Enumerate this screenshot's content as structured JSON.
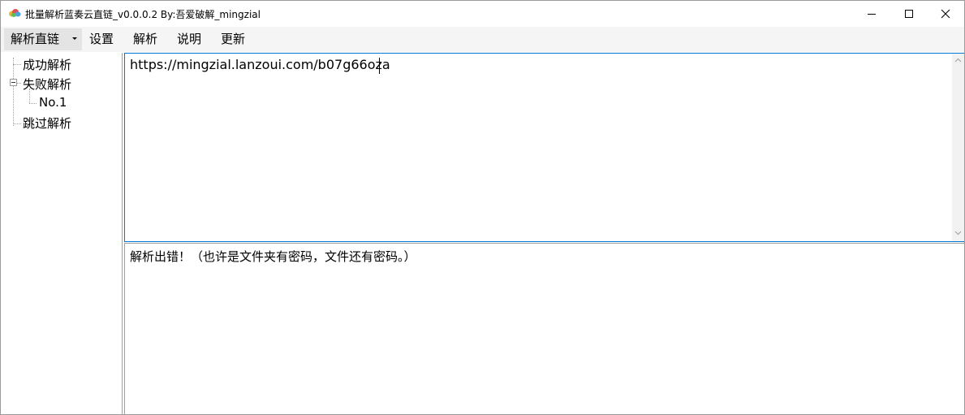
{
  "window": {
    "title": "批量解析蓝奏云直链_v0.0.0.2 By:吾爱破解_mingzial",
    "controls": {
      "minimize": "minimize",
      "maximize": "maximize",
      "close": "close"
    }
  },
  "menu": {
    "split_button": "解析直链",
    "items": [
      "设置",
      "解析",
      "说明",
      "更新"
    ]
  },
  "tree": {
    "nodes": [
      {
        "label": "成功解析",
        "level": 0
      },
      {
        "label": "失败解析",
        "level": 0,
        "expanded": true
      },
      {
        "label": "No.1",
        "level": 1
      },
      {
        "label": "跳过解析",
        "level": 0
      }
    ]
  },
  "input": {
    "url": "https://mingzial.lanzoui.com/b07g66oza"
  },
  "output": {
    "message": "解析出错！（也许是文件夹有密码，文件还有密码。）"
  },
  "icons": {
    "app": "cloud-icon",
    "scroll_up": "chevron-up-icon",
    "scroll_down": "chevron-down-icon"
  },
  "colors": {
    "focus_border": "#0078d7",
    "menu_bg": "#f5f5f5",
    "split_bg": "#e4e4e4"
  }
}
